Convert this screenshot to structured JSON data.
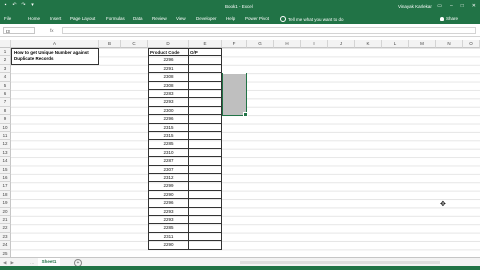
{
  "titlebar": {
    "quick_access": [
      "save-icon",
      "undo-icon",
      "redo-icon",
      "customize-icon"
    ],
    "title": "Book1 - Excel",
    "user": "Vinayak Karlekar",
    "window_controls": [
      "ribbon-display-icon",
      "minimize-icon",
      "restore-icon",
      "close-icon"
    ]
  },
  "ribbon": {
    "tabs": [
      "File",
      "Home",
      "Insert",
      "Page Layout",
      "Formulas",
      "Data",
      "Review",
      "View",
      "Developer",
      "Help",
      "Power Pivot"
    ],
    "tell_me": "Tell me what you want to do",
    "share": "Share"
  },
  "formula_bar": {
    "name_box": "I3",
    "fx": "fx",
    "value": ""
  },
  "columns": [
    "A",
    "B",
    "C",
    "D",
    "E",
    "F",
    "G",
    "H",
    "I",
    "J",
    "K",
    "L",
    "M",
    "N",
    "O"
  ],
  "rows": [
    "1",
    "2",
    "3",
    "4",
    "5",
    "6",
    "7",
    "8",
    "9",
    "10",
    "11",
    "12",
    "13",
    "14",
    "15",
    "16",
    "17",
    "18",
    "19",
    "20",
    "21",
    "22",
    "23",
    "24",
    "25"
  ],
  "cells": {
    "a1": "How to get Unique Number against Duplicate Records",
    "d1": "Product Code",
    "e1": "O/P",
    "product_codes": [
      "2296",
      "2291",
      "2308",
      "2308",
      "2283",
      "2293",
      "2300",
      "2296",
      "2315",
      "2315",
      "2285",
      "2310",
      "2287",
      "2307",
      "2312",
      "2299",
      "2290",
      "2296",
      "2293",
      "2293",
      "2285",
      "2311",
      "2290"
    ]
  },
  "sheets": {
    "active": "Sheet1",
    "add": "+"
  },
  "colors": {
    "accent": "#217346",
    "selection": "#bfbfbf"
  }
}
